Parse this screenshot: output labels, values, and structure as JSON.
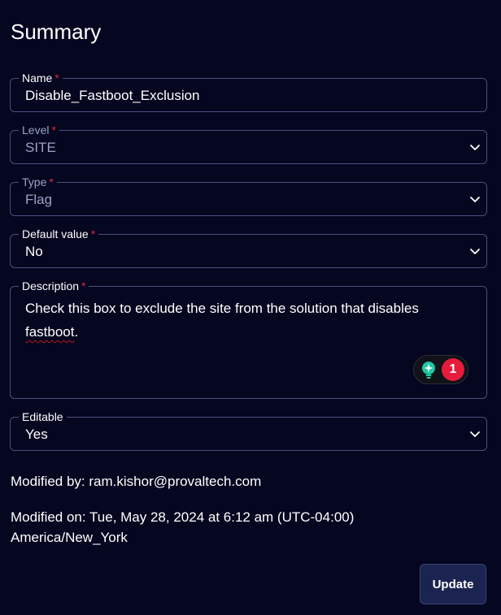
{
  "header": {
    "title": "Summary"
  },
  "form": {
    "required_marker": "*",
    "name": {
      "label": "Name",
      "value": "Disable_Fastboot_Exclusion"
    },
    "level": {
      "label": "Level",
      "value": "SITE",
      "icon": "chevron-down-icon"
    },
    "type": {
      "label": "Type",
      "value": "Flag",
      "icon": "chevron-down-icon"
    },
    "default_value": {
      "label": "Default value",
      "value": "No",
      "icon": "chevron-down-icon"
    },
    "description": {
      "label": "Description",
      "text_before": "Check this box to exclude the site from the solution that disables ",
      "misspelled_word": "fastboot",
      "text_after": ".",
      "assistant": {
        "icon": "lightbulb-icon",
        "count": "1",
        "badge_color": "#e51c3b"
      }
    },
    "editable": {
      "label": "Editable",
      "value": "Yes",
      "icon": "chevron-down-icon"
    }
  },
  "meta": {
    "modified_by": "Modified by: ram.kishor@provaltech.com",
    "modified_on_line1": "Modified on: Tue, May 28, 2024 at 6:12 am (UTC-04:00)",
    "modified_on_line2": "America/New_York"
  },
  "actions": {
    "update_label": "Update"
  },
  "colors": {
    "background": "#05061f",
    "border": "#4b5080",
    "required": "#e5243b",
    "muted_text": "#9aa3c7",
    "button_bg": "#1b2350"
  }
}
